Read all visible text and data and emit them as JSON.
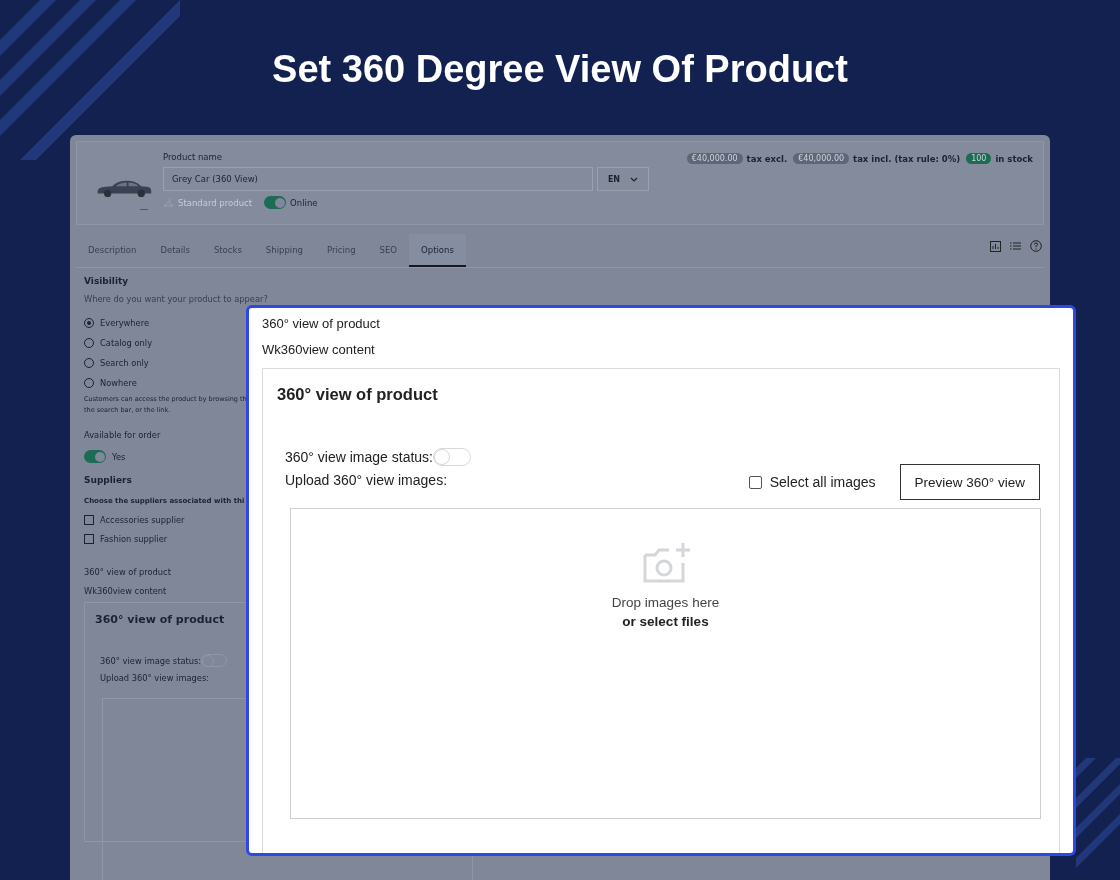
{
  "headline": "Set 360 Degree View Of Product",
  "product": {
    "image_caption": "—",
    "name_label": "Product name",
    "name_value": "Grey Car (360 View)",
    "language": "EN",
    "type_label": "Standard product",
    "online": {
      "label": "Online",
      "on": true
    },
    "summary": [
      {
        "kind": "price",
        "badge": "€40,000.00",
        "text": "tax excl."
      },
      {
        "kind": "price",
        "badge": "€40,000.00",
        "text": "tax incl. (tax rule: 0%)"
      },
      {
        "kind": "stock",
        "badge": "100",
        "text": "in stock"
      }
    ]
  },
  "tabs": [
    {
      "label": "Description",
      "selected": false
    },
    {
      "label": "Details",
      "selected": false
    },
    {
      "label": "Stocks",
      "selected": false
    },
    {
      "label": "Shipping",
      "selected": false
    },
    {
      "label": "Pricing",
      "selected": false
    },
    {
      "label": "SEO",
      "selected": false
    },
    {
      "label": "Options",
      "selected": true
    }
  ],
  "visibility": {
    "title": "Visibility",
    "question": "Where do you want your product to appear?",
    "options": [
      {
        "label": "Everywhere",
        "selected": true
      },
      {
        "label": "Catalog only",
        "selected": false
      },
      {
        "label": "Search only",
        "selected": false
      },
      {
        "label": "Nowhere",
        "selected": false
      }
    ],
    "note": [
      "Customers can access the product by browsing th",
      "the search bar, or the link."
    ]
  },
  "availability": {
    "label": "Available for order",
    "on": true,
    "value": "Yes"
  },
  "suppliers": {
    "title": "Suppliers",
    "subtitle": "Choose the suppliers associated with thi",
    "items": [
      {
        "label": "Accessories supplier",
        "checked": false
      },
      {
        "label": "Fashion supplier",
        "checked": false
      }
    ]
  },
  "module_behind": {
    "label": "360° view of product",
    "content_label": "Wk360view content",
    "card_title": "360° view of product",
    "status_label": "360° view image status:",
    "status_on": false,
    "upload_label": "Upload 360° view images:"
  },
  "popup": {
    "label": "360° view of product",
    "content_label": "Wk360view content",
    "card_title": "360° view of product",
    "status_label": "360° view image status:",
    "status_on": false,
    "upload_label": "Upload 360° view images:",
    "select_all": {
      "label": "Select all images",
      "checked": false
    },
    "preview_button": "Preview 360° view",
    "drop_text": "Drop images here",
    "select_files": "or select files"
  }
}
